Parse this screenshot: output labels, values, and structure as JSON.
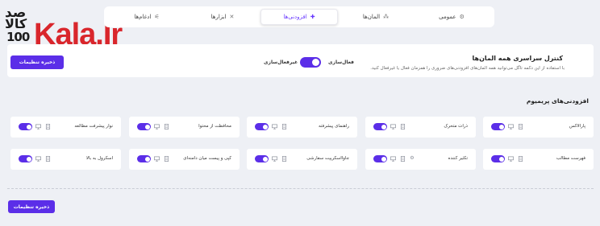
{
  "watermark": {
    "top": "صد",
    "mid": "کالا",
    "num": "100",
    "word": "Kala.Ir"
  },
  "tabs": [
    {
      "label": "عمومی",
      "icon": "gear-icon",
      "active": false
    },
    {
      "label": "المان‌ها",
      "icon": "elements-icon",
      "active": false
    },
    {
      "label": "افزودنی‌ها",
      "icon": "puzzle-icon",
      "active": true
    },
    {
      "label": "ابزارها",
      "icon": "tools-icon",
      "active": false
    },
    {
      "label": "ادغام‌ها",
      "icon": "integration-icon",
      "active": false
    }
  ],
  "control": {
    "title": "کنترل سراسری همه المان‌ها",
    "description": "با استفاده از این دکمه تاگل می‌توانید همه المان‌های افزودنی‌های ضروری را همزمان فعال یا غیرفعال کنید.",
    "enable_label": "فعال‌سازی",
    "disable_label": "غیرفعال‌سازی",
    "toggle_on": true
  },
  "save_label": "ذخیره تنظیمات",
  "section_title": "افزودنی‌های پریمیوم",
  "features": [
    {
      "label": "پارالاکس",
      "icons": [
        "doc-icon",
        "monitor-icon"
      ],
      "enabled": true
    },
    {
      "label": "ذرات متحرک",
      "icons": [
        "doc-icon",
        "monitor-icon"
      ],
      "enabled": true
    },
    {
      "label": "راهنمای پیشرفته",
      "icons": [
        "doc-icon",
        "monitor-icon"
      ],
      "enabled": true
    },
    {
      "label": "محافظت از محتوا",
      "icons": [
        "doc-icon",
        "monitor-icon"
      ],
      "enabled": true
    },
    {
      "label": "نوار پیشرفت مطالعه",
      "icons": [
        "doc-icon",
        "monitor-icon"
      ],
      "enabled": true
    },
    {
      "label": "فهرست مطالب",
      "icons": [
        "doc-icon",
        "monitor-icon"
      ],
      "enabled": true
    },
    {
      "label": "تکثیر کننده",
      "icons": [
        "gear-icon",
        "doc-icon",
        "monitor-icon"
      ],
      "enabled": true
    },
    {
      "label": "جاوااسکریپت سفارشی",
      "icons": [
        "doc-icon",
        "monitor-icon"
      ],
      "enabled": true
    },
    {
      "label": "کپی و پیست میان دامنه‌ای",
      "icons": [
        "doc-icon",
        "monitor-icon"
      ],
      "enabled": true
    },
    {
      "label": "اسکرول به بالا",
      "icons": [
        "doc-icon",
        "monitor-icon"
      ],
      "enabled": true
    }
  ],
  "colors": {
    "accent": "#5b2ee8",
    "background": "#eef0f5",
    "logo_red": "#d9262c"
  }
}
